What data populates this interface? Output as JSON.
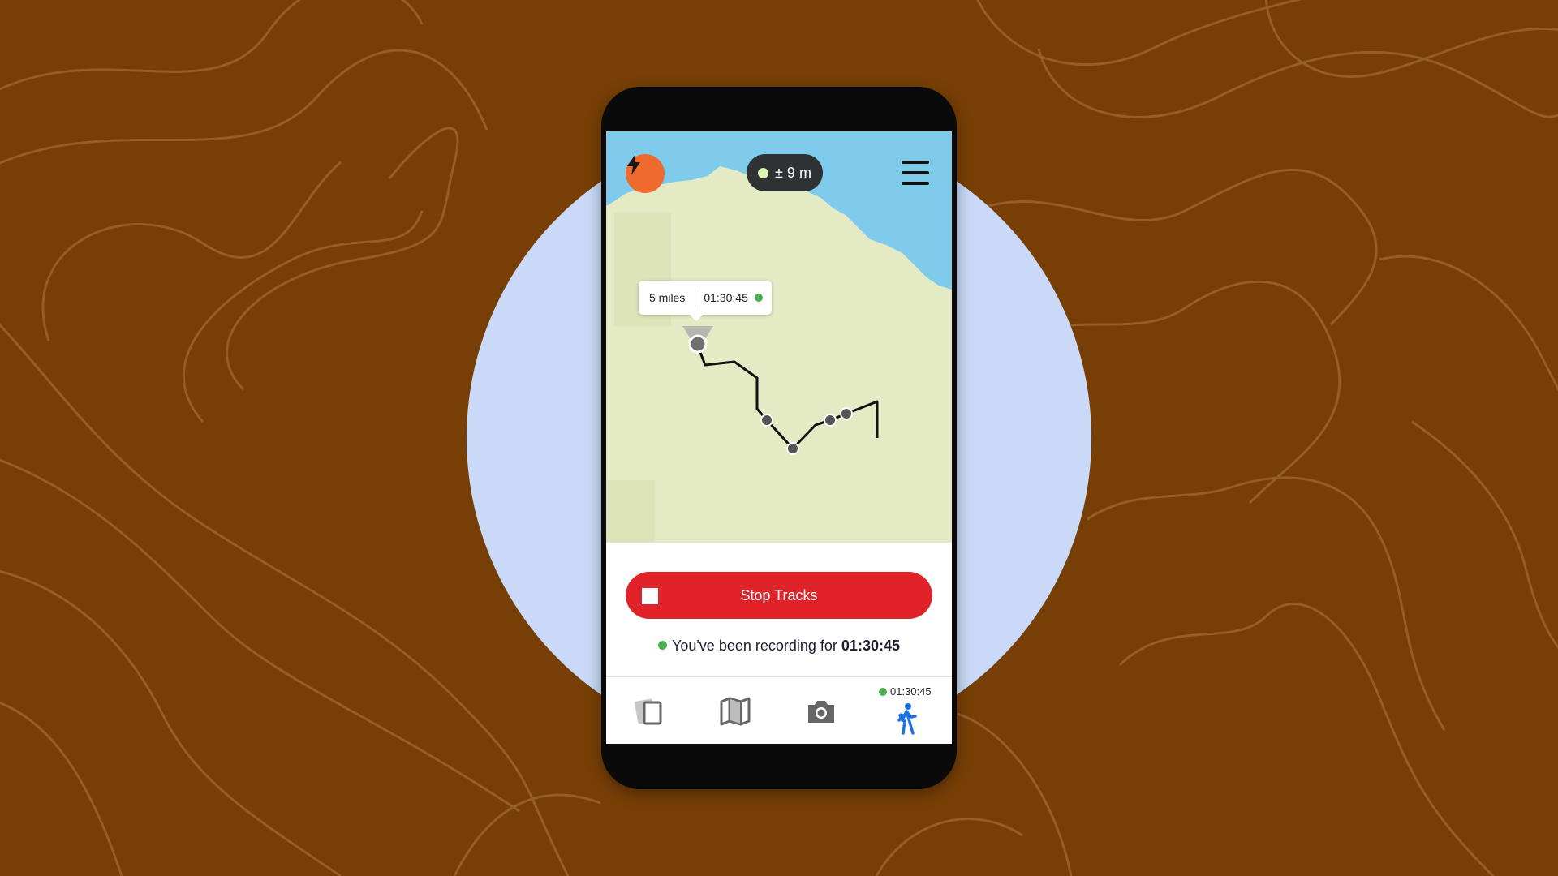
{
  "app": {
    "accuracy": "± 9 m",
    "tooltip": {
      "distance": "5 miles",
      "time": "01:30:45"
    },
    "stop_button_label": "Stop Tracks",
    "recording": {
      "prefix": "You've been recording for ",
      "time": "01:30:45"
    },
    "nav": {
      "tabs": [
        {
          "name": "cards",
          "icon": "cards-icon"
        },
        {
          "name": "maps",
          "icon": "map-icon"
        },
        {
          "name": "photos",
          "icon": "camera-icon"
        },
        {
          "name": "tracks",
          "icon": "hiker-icon",
          "active": true
        }
      ],
      "track_timer": "01:30:45"
    }
  },
  "colors": {
    "background": "#773f06",
    "circle": "#c9d9f7",
    "water": "#7ecbec",
    "land": "#e4ebc4",
    "bolt_button": "#ee6a2d",
    "stop_button": "#e02328",
    "status_green": "#4caf50",
    "active_tab": "#1a73e8"
  }
}
